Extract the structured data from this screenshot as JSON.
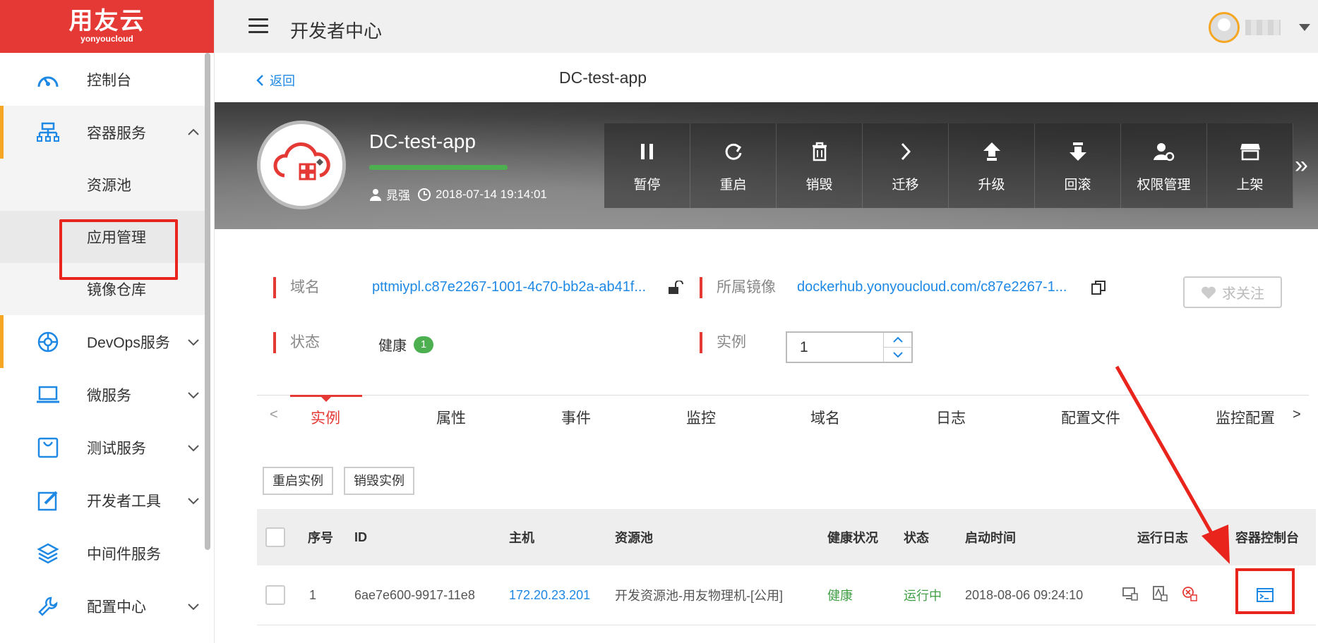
{
  "brand": {
    "name": "用友云",
    "sub": "yonyoucloud",
    "color": "#e53935"
  },
  "header": {
    "title": "开发者中心"
  },
  "sidebar": {
    "items": [
      {
        "label": "控制台",
        "icon": "dashboard-icon"
      },
      {
        "label": "容器服务",
        "icon": "container-icon",
        "expanded": true
      },
      {
        "label": "资源池"
      },
      {
        "label": "应用管理",
        "selected": true
      },
      {
        "label": "镜像仓库"
      },
      {
        "label": "DevOps服务",
        "icon": "devops-icon"
      },
      {
        "label": "微服务",
        "icon": "laptop-icon"
      },
      {
        "label": "测试服务",
        "icon": "bag-icon"
      },
      {
        "label": "开发者工具",
        "icon": "edit-icon"
      },
      {
        "label": "中间件服务",
        "icon": "layers-icon"
      },
      {
        "label": "配置中心",
        "icon": "wrench-icon"
      }
    ]
  },
  "page": {
    "back_label": "返回",
    "title": "DC-test-app"
  },
  "app": {
    "name": "DC-test-app",
    "owner": "晁强",
    "created": "2018-07-14 19:14:01",
    "actions": [
      "暂停",
      "重启",
      "销毁",
      "迁移",
      "升级",
      "回滚",
      "权限管理",
      "上架"
    ]
  },
  "info": {
    "domain_label": "域名",
    "domain_value": "pttmiypl.c87e2267-1001-4c70-bb2a-ab41f...",
    "image_label": "所属镜像",
    "image_value": "dockerhub.yonyoucloud.com/c87e2267-1...",
    "status_label": "状态",
    "status_value": "健康",
    "status_count": "1",
    "instance_label": "实例",
    "instance_value": "1",
    "follow_label": "求关注"
  },
  "tabs": [
    "实例",
    "属性",
    "事件",
    "监控",
    "域名",
    "日志",
    "配置文件",
    "监控配置"
  ],
  "tab_nav": {
    "prev": "<",
    "next": ">"
  },
  "buttons": {
    "restart": "重启实例",
    "destroy": "销毁实例"
  },
  "table": {
    "headers": [
      "序号",
      "ID",
      "主机",
      "资源池",
      "健康状况",
      "状态",
      "启动时间",
      "运行日志",
      "容器控制台"
    ],
    "rows": [
      {
        "index": "1",
        "id": "6ae7e600-9917-11e8",
        "host": "172.20.23.201",
        "pool": "开发资源池-用友物理机-[公用]",
        "health": "健康",
        "status": "运行中",
        "started": "2018-08-06 09:24:10"
      }
    ]
  }
}
